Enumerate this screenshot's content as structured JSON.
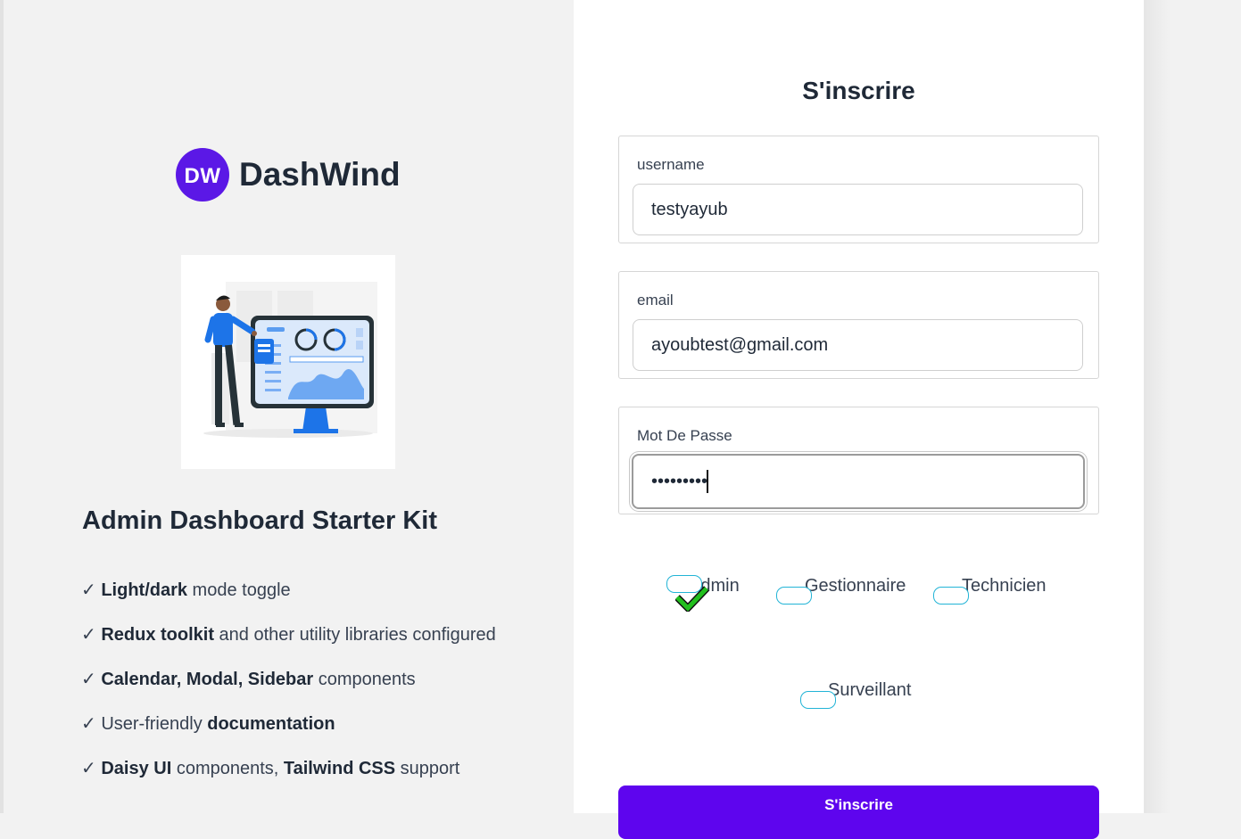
{
  "brand": {
    "logo_text": "DW",
    "name": "DashWind"
  },
  "hero": {
    "title": "Admin Dashboard Starter Kit",
    "illustration_icon": "dashboard-illustration-icon"
  },
  "features": [
    {
      "check": "✓",
      "bold": "Light/dark",
      "text": " mode toggle"
    },
    {
      "check": "✓",
      "bold": "Redux toolkit",
      "text": " and other utility libraries configured"
    },
    {
      "check": "✓",
      "bold": "Calendar, Modal, Sidebar",
      "text": " components"
    },
    {
      "check": "✓",
      "pre": "User-friendly ",
      "bold": "documentation"
    },
    {
      "check": "✓",
      "bold": "Daisy UI",
      "text": " components, ",
      "bold2": "Tailwind CSS",
      "text2": " support"
    }
  ],
  "form": {
    "title": "S'inscrire",
    "username": {
      "label": "username",
      "value": "testyayub"
    },
    "email": {
      "label": "email",
      "value": "ayoubtest@gmail.com"
    },
    "password": {
      "label": "Mot De Passe",
      "value": "testyayub"
    },
    "roles": [
      {
        "label": "Admin",
        "checked": true
      },
      {
        "label": "Gestionnaire",
        "checked": false
      },
      {
        "label": "Technicien",
        "checked": false
      },
      {
        "label": "Surveillant",
        "checked": false
      }
    ],
    "submit_label": "S'inscrire"
  },
  "colors": {
    "brand": "#5b18e6",
    "button": "#5e05ee",
    "checkbox_border": "#22b4d6",
    "check_green": "#22c01e",
    "left_bg": "#f2f2f2",
    "right_bg": "#ffffff"
  }
}
